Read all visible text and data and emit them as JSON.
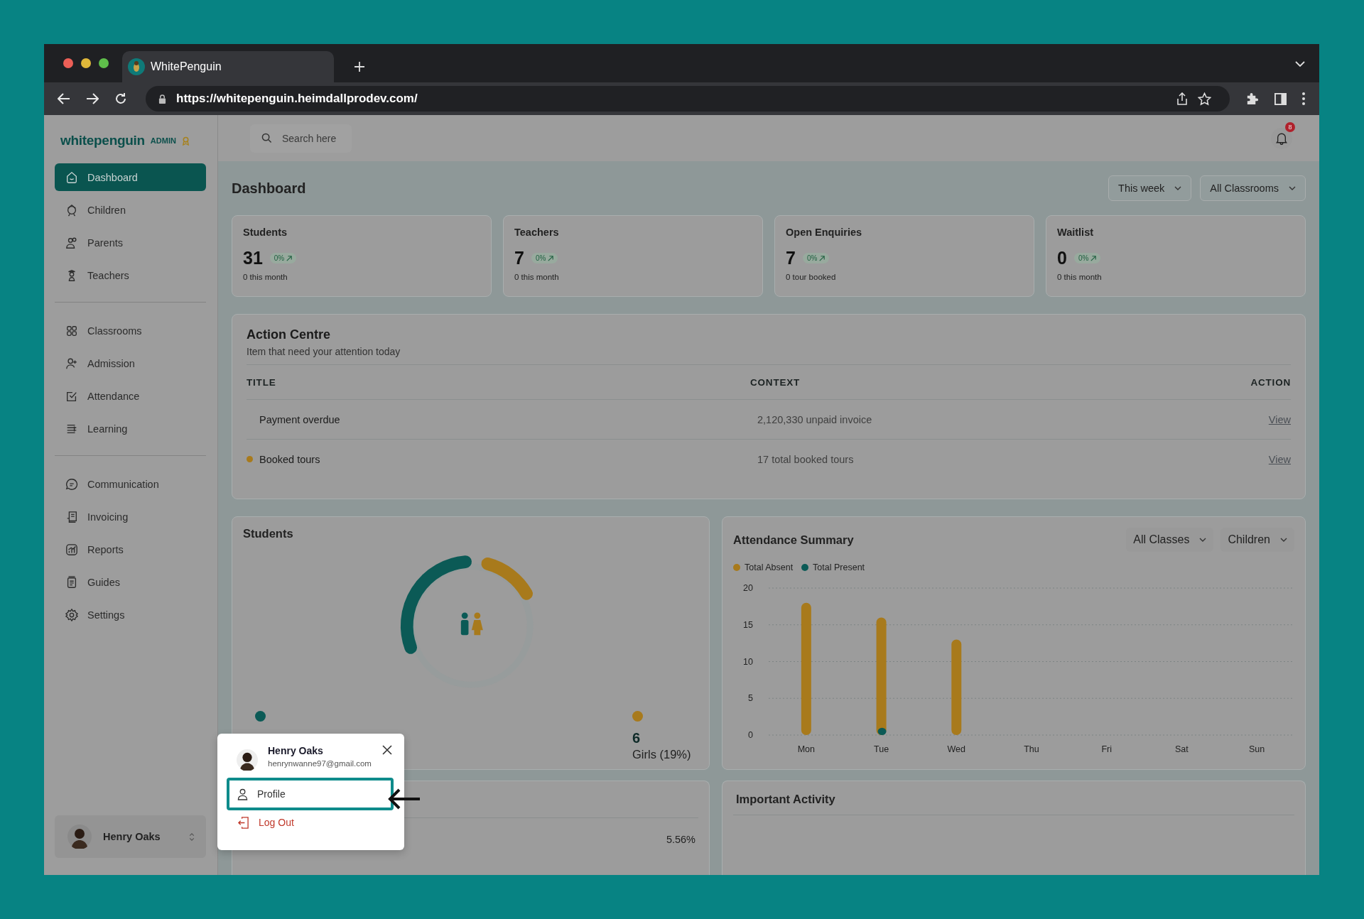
{
  "browser": {
    "tab_title": "WhitePenguin",
    "url": "https://whitepenguin.heimdallprodev.com/"
  },
  "sidebar": {
    "logo": "whitepenguin",
    "role": "ADMIN",
    "sections": [
      {
        "items": [
          {
            "label": "Dashboard",
            "selected": true
          },
          {
            "label": "Children",
            "selected": false
          },
          {
            "label": "Parents",
            "selected": false
          },
          {
            "label": "Teachers",
            "selected": false
          }
        ]
      },
      {
        "items": [
          {
            "label": "Classrooms",
            "selected": false
          },
          {
            "label": "Admission",
            "selected": false
          },
          {
            "label": "Attendance",
            "selected": false
          },
          {
            "label": "Learning",
            "selected": false
          }
        ]
      },
      {
        "items": [
          {
            "label": "Communication",
            "selected": false
          },
          {
            "label": "Invoicing",
            "selected": false
          },
          {
            "label": "Reports",
            "selected": false
          },
          {
            "label": "Guides",
            "selected": false
          },
          {
            "label": "Settings",
            "selected": false
          }
        ]
      }
    ],
    "user": {
      "name": "Henry Oaks"
    }
  },
  "header": {
    "search": {
      "placeholder": "Search here"
    },
    "notifications": "8"
  },
  "page": {
    "title": "Dashboard",
    "filters": [
      "This week",
      "All Classrooms"
    ]
  },
  "stats": [
    {
      "label": "Students",
      "value": "31",
      "change": "0%",
      "note": "0 this month"
    },
    {
      "label": "Teachers",
      "value": "7",
      "change": "0%",
      "note": "0 this month"
    },
    {
      "label": "Open Enquiries",
      "value": "7",
      "change": "0%",
      "note": "0 tour booked"
    },
    {
      "label": "Waitlist",
      "value": "0",
      "change": "0%",
      "note": "0 this month"
    }
  ],
  "action_centre": {
    "title": "Action Centre",
    "subtitle": "Item that need your attention today",
    "columns": [
      "TITLE",
      "CONTEXT",
      "ACTION"
    ],
    "rows": [
      {
        "title": "Payment overdue",
        "context": "2,120,330 unpaid invoice",
        "action": "View",
        "flagged": false
      },
      {
        "title": "Booked tours",
        "context": "17 total booked tours",
        "action": "View",
        "flagged": true
      }
    ]
  },
  "students_card": {
    "title": "Students",
    "girls": {
      "count": "6",
      "label": "Girls (19%)"
    }
  },
  "attendance": {
    "title": "Attendance Summary",
    "filters": [
      "All Classes",
      "Children"
    ],
    "chart_data": {
      "type": "bar",
      "categories": [
        "Mon",
        "Tue",
        "Wed",
        "Thu",
        "Fri",
        "Sat",
        "Sun"
      ],
      "series": [
        {
          "name": "Total Absent",
          "color": "#a87a1c",
          "values": [
            18,
            16,
            13,
            0,
            0,
            0,
            0
          ]
        },
        {
          "name": "Total Present",
          "color": "#0b5a56",
          "values": [
            0,
            1,
            0,
            0,
            0,
            0,
            0
          ]
        }
      ],
      "ylim": [
        0,
        20
      ],
      "yticks": [
        0,
        5,
        10,
        15,
        20
      ],
      "grid": true
    }
  },
  "bottom_left_card": {
    "value": "5.56%"
  },
  "important_activity": {
    "title": "Important Activity"
  },
  "profile_menu": {
    "name": "Henry Oaks",
    "email": "henrynwanne97@gmail.com",
    "items": [
      {
        "label": "Profile",
        "kind": "normal",
        "selected": true
      },
      {
        "label": "Log Out",
        "kind": "danger",
        "selected": false
      }
    ]
  }
}
